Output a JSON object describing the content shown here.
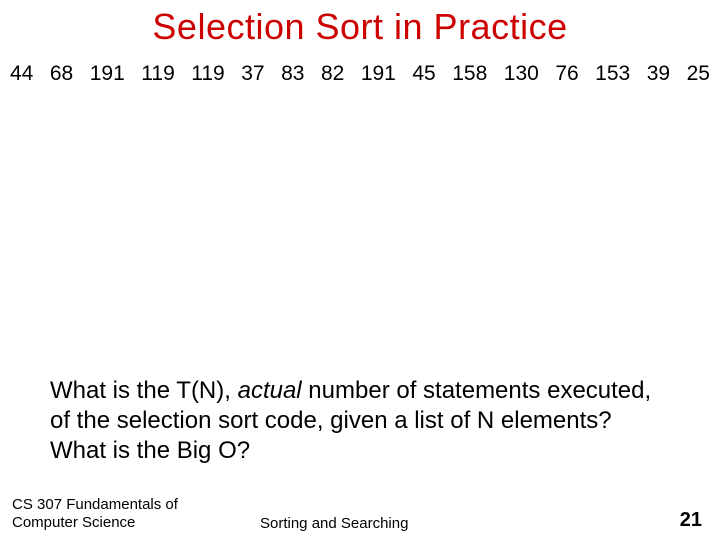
{
  "title": "Selection Sort in Practice",
  "numbers": [
    "44",
    "68",
    "191",
    "119",
    "119",
    "37",
    "83",
    "82",
    "191",
    "45",
    "158",
    "130",
    "76",
    "153",
    "39",
    "25"
  ],
  "question": {
    "p1a": "What is the T(N), ",
    "p1b": "actual",
    "p1c": " number of statements executed, of the selection sort code, given a list of N  elements? What is the Big O?"
  },
  "footer": {
    "left_line1": "CS 307 Fundamentals of",
    "left_line2": "Computer Science",
    "center": "Sorting and Searching",
    "page": "21"
  }
}
